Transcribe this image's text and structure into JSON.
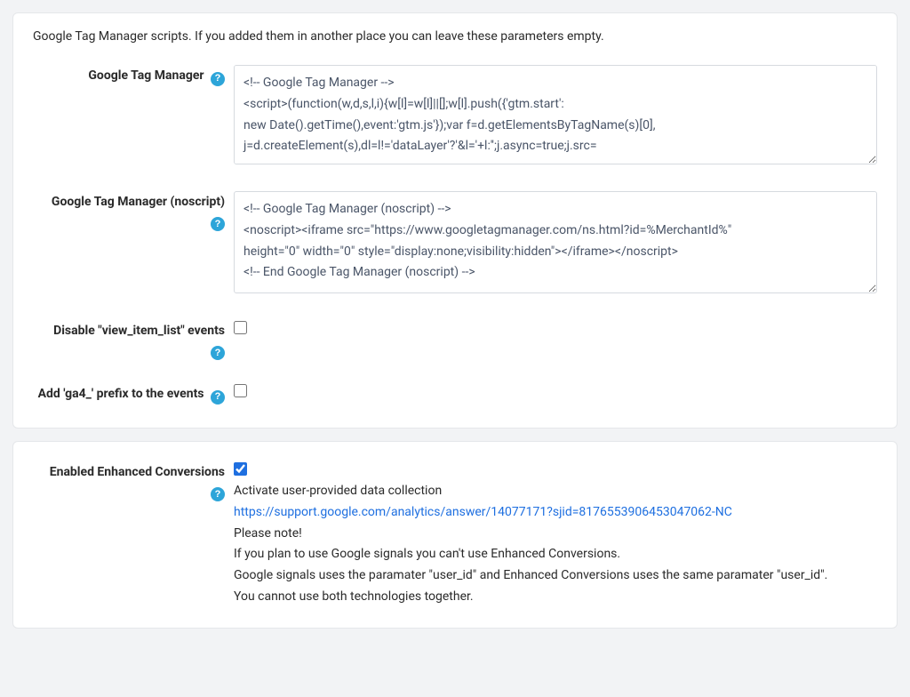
{
  "intro": "Google Tag Manager scripts. If you added them in another place you can leave these parameters empty.",
  "fields": {
    "gtm": {
      "label": "Google Tag Manager",
      "value": "<!-- Google Tag Manager -->\n<script>(function(w,d,s,l,i){w[l]=w[l]||[];w[l].push({'gtm.start':\nnew Date().getTime(),event:'gtm.js'});var f=d.getElementsByTagName(s)[0],\nj=d.createElement(s),dl=l!='dataLayer'?'&l='+l:'';j.async=true;j.src="
    },
    "gtm_noscript": {
      "label": "Google Tag Manager (noscript)",
      "value": "<!-- Google Tag Manager (noscript) -->\n<noscript><iframe src=\"https://www.googletagmanager.com/ns.html?id=%MerchantId%\"\nheight=\"0\" width=\"0\" style=\"display:none;visibility:hidden\"></iframe></noscript>\n<!-- End Google Tag Manager (noscript) -->"
    },
    "disable_view_item_list": {
      "label": "Disable \"view_item_list\" events",
      "checked": false
    },
    "add_ga4_prefix": {
      "label": "Add 'ga4_' prefix to the events",
      "checked": false
    },
    "enhanced_conversions": {
      "label": "Enabled Enhanced Conversions",
      "checked": true,
      "desc_line1": "Activate user-provided data collection",
      "link_text": "https://support.google.com/analytics/answer/14077171?sjid=8176553906453047062-NC",
      "link_href": "https://support.google.com/analytics/answer/14077171?sjid=8176553906453047062-NC",
      "desc_line3": "Please note!",
      "desc_line4": "If you plan to use Google signals you can't use Enhanced Conversions.",
      "desc_line5": "Google signals uses the paramater \"user_id\" and Enhanced Conversions uses the same paramater \"user_id\".",
      "desc_line6": "You cannot use both technologies together."
    }
  },
  "help_glyph": "?"
}
